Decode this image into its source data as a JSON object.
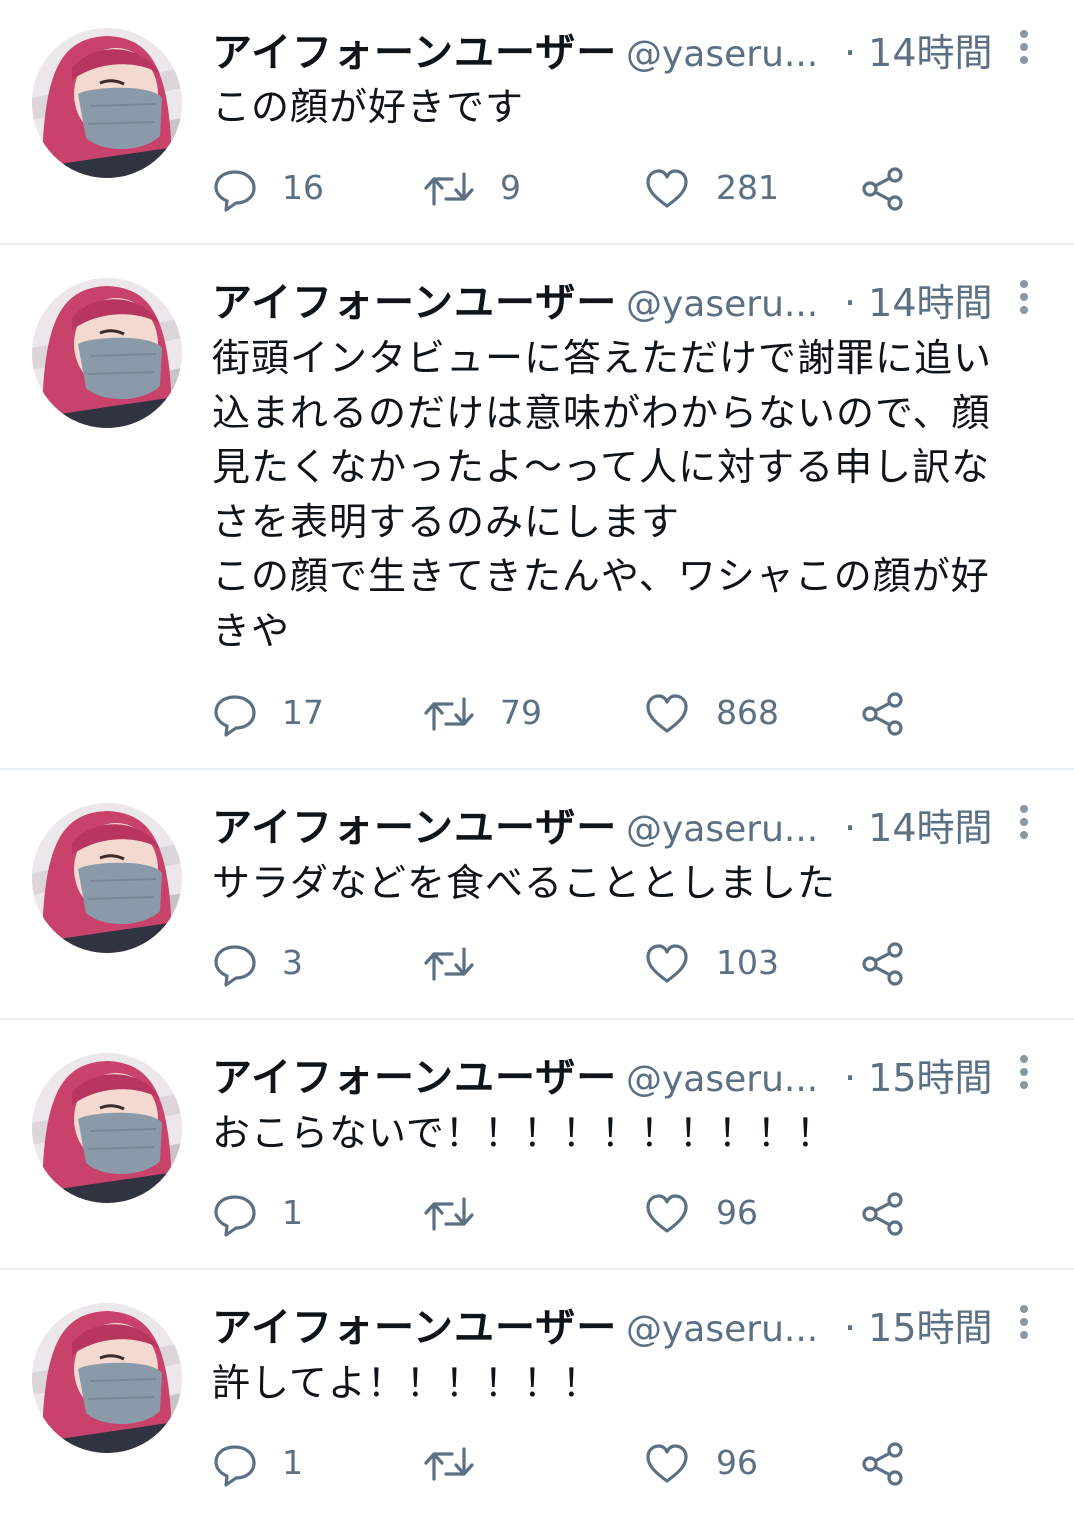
{
  "colors": {
    "text": "#0f1419",
    "muted": "#5b7083",
    "divider": "#e6ecf0"
  },
  "tweets": [
    {
      "name": "アイフォーンユーザー",
      "handle": "@yaseru...",
      "time": "· 14時間",
      "text": "この顔が好きです",
      "replies": "16",
      "retweets": "9",
      "likes": "281"
    },
    {
      "name": "アイフォーンユーザー",
      "handle": "@yaseru...",
      "time": "· 14時間",
      "text": "街頭インタビューに答えただけで謝罪に追い\n込まれるのだけは意味がわからないので、顔\n見たくなかったよ〜って人に対する申し訳な\nさを表明するのみにします\nこの顔で生きてきたんや、ワシャこの顔が好\nきや",
      "replies": "17",
      "retweets": "79",
      "likes": "868"
    },
    {
      "name": "アイフォーンユーザー",
      "handle": "@yaseru...",
      "time": "· 14時間",
      "text": "サラダなどを食べることとしました",
      "replies": "3",
      "retweets": "",
      "likes": "103"
    },
    {
      "name": "アイフォーンユーザー",
      "handle": "@yaseru...",
      "time": "· 15時間",
      "text": "おこらないで！！！！！！！！！！",
      "replies": "1",
      "retweets": "",
      "likes": "96"
    },
    {
      "name": "アイフォーンユーザー",
      "handle": "@yaseru...",
      "time": "· 15時間",
      "text": "許してよ！！！！！！",
      "replies": "1",
      "retweets": "",
      "likes": "96"
    }
  ],
  "icons": {
    "reply": "reply-icon",
    "retweet": "retweet-icon",
    "like": "heart-icon",
    "share": "share-icon",
    "more": "more-vertical-icon"
  }
}
